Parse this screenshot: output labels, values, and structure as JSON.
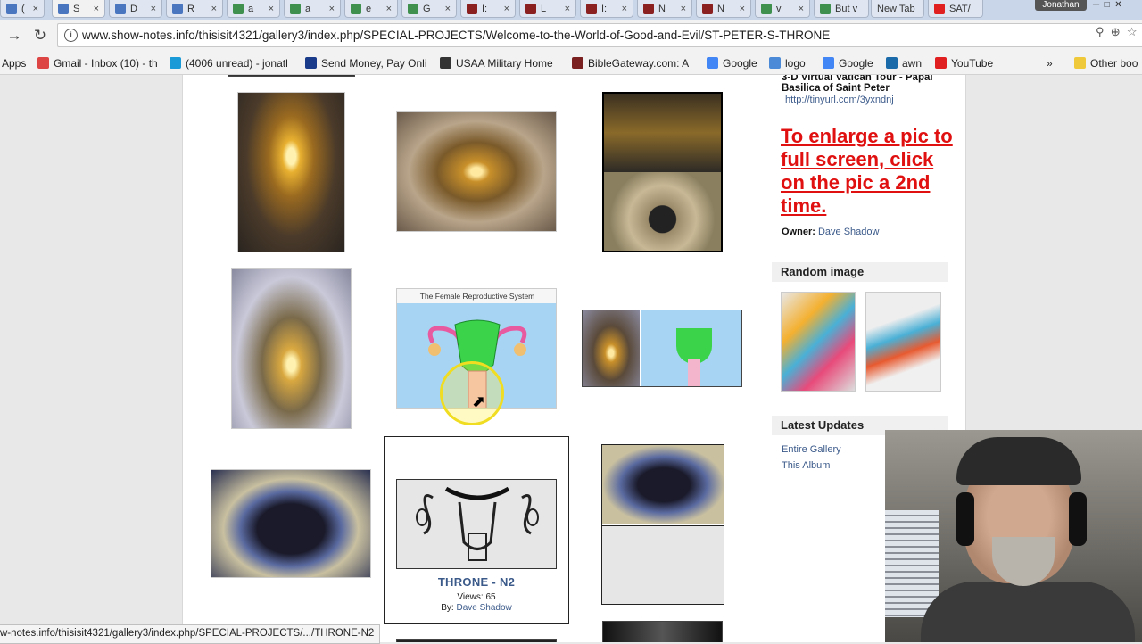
{
  "browser": {
    "tabs": [
      {
        "label": "(",
        "color": "#4a76c0"
      },
      {
        "label": "S",
        "color": "#4a76c0",
        "active": true
      },
      {
        "label": "D",
        "color": "#4a76c0"
      },
      {
        "label": "R",
        "color": "#4a76c0"
      },
      {
        "label": "a",
        "color": "#3f8f4f"
      },
      {
        "label": "a",
        "color": "#3f8f4f"
      },
      {
        "label": "e",
        "color": "#3f8f4f"
      },
      {
        "label": "G",
        "color": "#3f8f4f"
      },
      {
        "label": "I:",
        "color": "#8a2020"
      },
      {
        "label": "L",
        "color": "#8a2020"
      },
      {
        "label": "I:",
        "color": "#8a2020"
      },
      {
        "label": "N",
        "color": "#8a2020"
      },
      {
        "label": "N",
        "color": "#8a2020"
      },
      {
        "label": "v",
        "color": "#3f8f4f"
      },
      {
        "label": "But v",
        "color": "#3f8f4f"
      },
      {
        "label": "New Tab",
        "color": ""
      },
      {
        "label": "SAT/",
        "color": "#e02020"
      }
    ],
    "user": "Jonathan",
    "url": "www.show-notes.info/thisisit4321/gallery3/index.php/SPECIAL-PROJECTS/Welcome-to-the-World-of-Good-and-Evil/ST-PETER-S-THRONE",
    "bookmarks": [
      {
        "label": "Apps",
        "icon": "apps-grid-icon",
        "color": "#666"
      },
      {
        "label": "Gmail - Inbox (10) - th",
        "icon": "gmail-icon",
        "color": "#d44"
      },
      {
        "label": "(4006 unread) - jonatl",
        "icon": "att-icon",
        "color": "#1a9ad6"
      },
      {
        "label": "Send Money, Pay Onli",
        "icon": "paypal-icon",
        "color": "#1a3a8a"
      },
      {
        "label": "USAA Military Home",
        "icon": "usaa-icon",
        "color": "#333"
      },
      {
        "label": "BibleGateway.com: A",
        "icon": "biblegateway-icon",
        "color": "#7a2020"
      },
      {
        "label": "Google",
        "icon": "google-icon",
        "color": "#4285f4"
      },
      {
        "label": "logo",
        "icon": "logo-icon",
        "color": "#4a8ad6"
      },
      {
        "label": "Google",
        "icon": "google-icon",
        "color": "#4285f4"
      },
      {
        "label": "awn",
        "icon": "awn-icon",
        "color": "#1a6aaa"
      },
      {
        "label": "YouTube",
        "icon": "youtube-icon",
        "color": "#e02020"
      }
    ],
    "more_bookmarks": "»",
    "other_bookmarks": "Other boo",
    "status_url": "w-notes.info/thisisit4321/gallery3/index.php/SPECIAL-PROJECTS/.../THRONE-N2"
  },
  "sidebar": {
    "description": "3-D Virtual Vatican Tour - Papal Basilica of Saint Peter",
    "link": "http://tinyurl.com/3yxndnj",
    "enlarge_note": "To enlarge a pic to full screen, click on the pic a 2nd time.",
    "owner_label": "Owner:",
    "owner_name": "Dave Shadow",
    "random_image_heading": "Random image",
    "latest_updates_heading": "Latest Updates",
    "latest_updates": [
      "Entire Gallery",
      "This Album"
    ]
  },
  "gallery": {
    "selected_item": {
      "title": "THRONE - N2",
      "views": "Views: 65",
      "by_label": "By:",
      "by_name": "Dave Shadow"
    },
    "diagram_caption": "The Female Reproductive System"
  },
  "colors": {
    "link": "#3b5a8a",
    "alert": "#e01010"
  }
}
